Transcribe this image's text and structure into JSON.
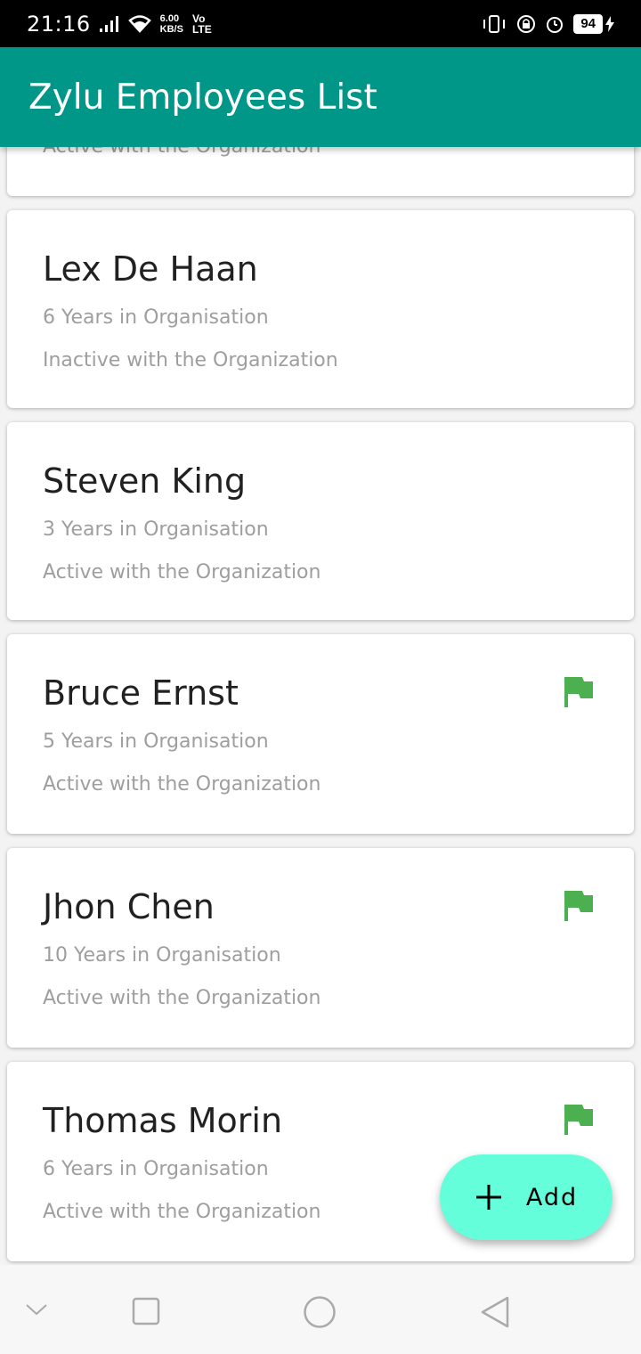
{
  "status_bar": {
    "time": "21:16",
    "speed_value": "6.00",
    "speed_unit": "KB/S",
    "network_top": "Vo",
    "network_bottom": "LTE",
    "battery": "94"
  },
  "app_bar": {
    "title": "Zylu Employees List"
  },
  "partial_card": {
    "status": "Active with the Organization"
  },
  "employees": [
    {
      "name": "Lex De Haan",
      "years": "6 Years in Organisation",
      "status": "Inactive with the Organization",
      "flagged": false
    },
    {
      "name": "Steven King",
      "years": "3 Years in Organisation",
      "status": "Active with the Organization",
      "flagged": false
    },
    {
      "name": "Bruce Ernst",
      "years": "5 Years in Organisation",
      "status": "Active with the Organization",
      "flagged": true
    },
    {
      "name": "Jhon Chen",
      "years": "10 Years in Organisation",
      "status": "Active with the Organization",
      "flagged": true
    },
    {
      "name": "Thomas Morin",
      "years": "6 Years in Organisation",
      "status": "Active with the Organization",
      "flagged": true
    }
  ],
  "fab": {
    "icon": "plus-icon",
    "label": "Add"
  },
  "colors": {
    "app_bar": "#009688",
    "fab": "#64ffda",
    "flag": "#4caf50"
  }
}
